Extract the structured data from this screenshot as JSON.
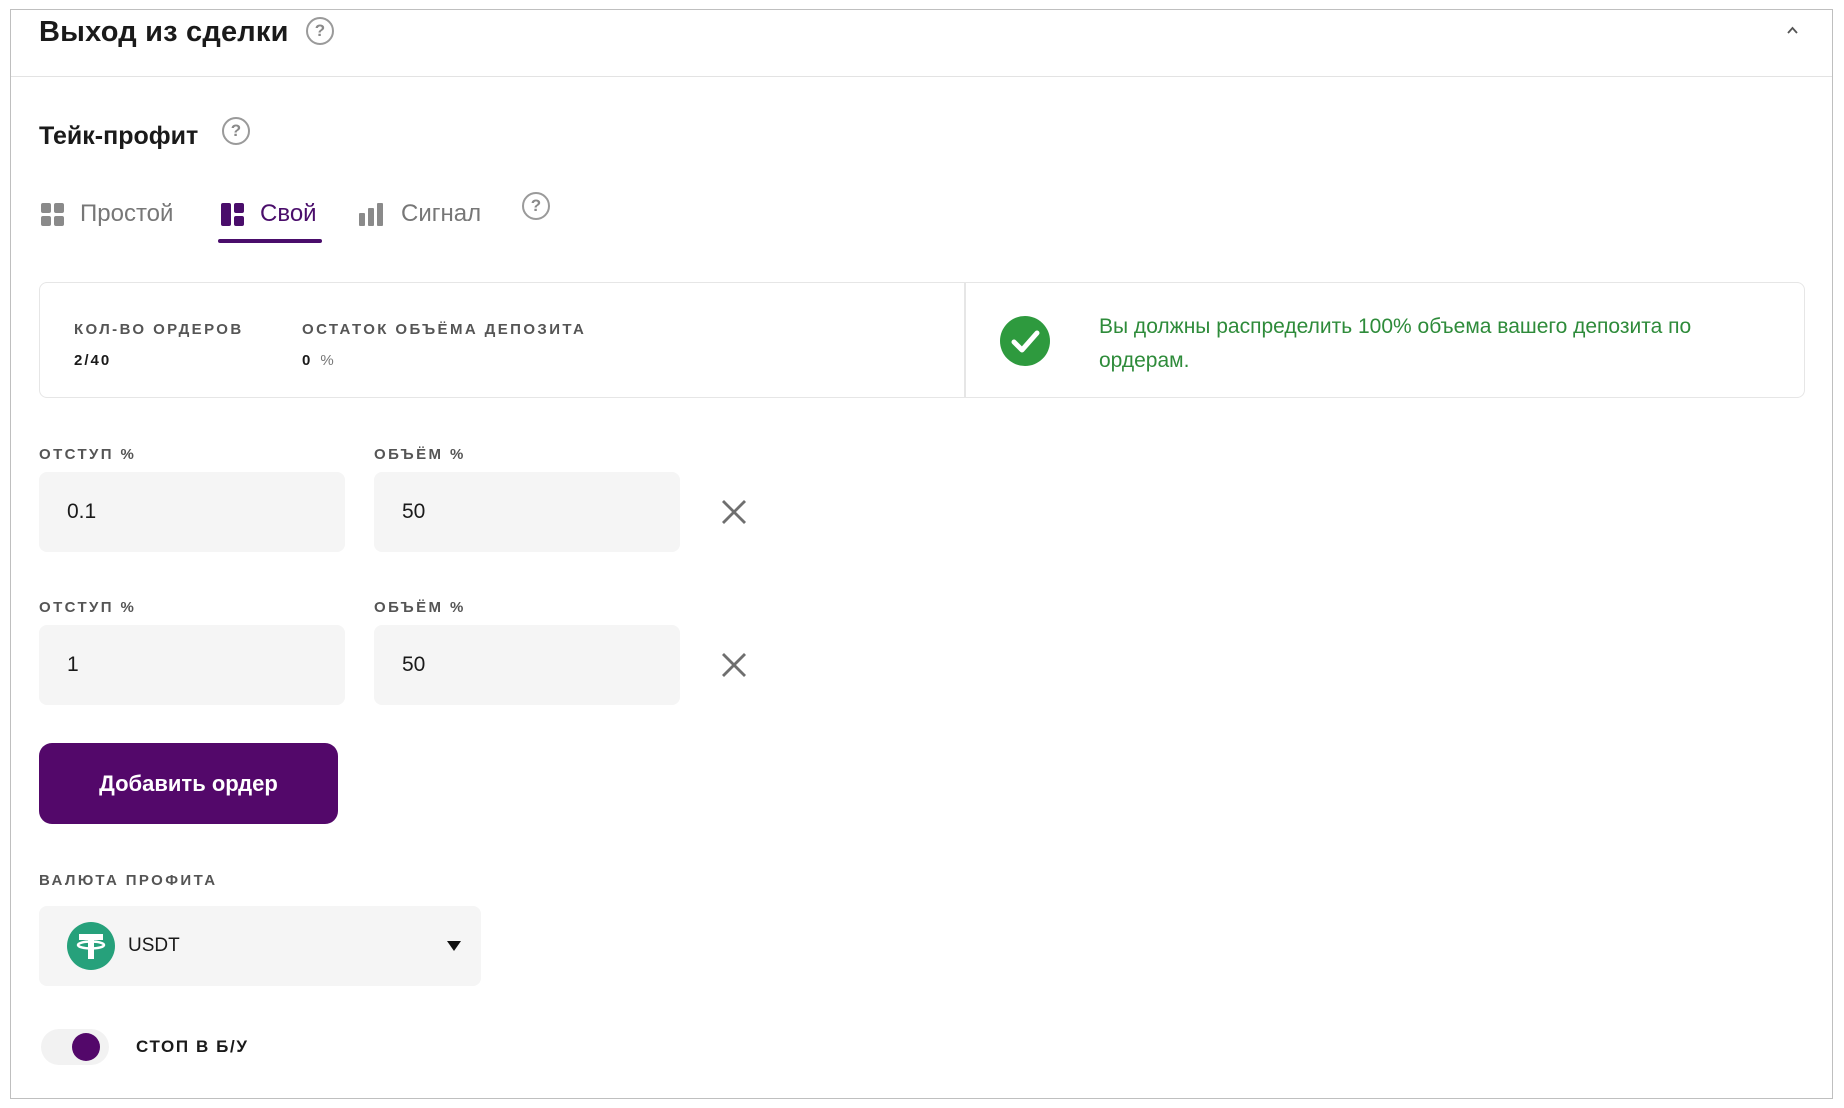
{
  "header": {
    "title": "Выход из сделки",
    "help_glyph": "?"
  },
  "section": {
    "title": "Тейк-профит",
    "help_glyph": "?"
  },
  "tabs": [
    {
      "label": "Простой",
      "icon": "grid-icon",
      "active": false
    },
    {
      "label": "Свой",
      "icon": "layout-icon",
      "active": true
    },
    {
      "label": "Сигнал",
      "icon": "bar-chart-icon",
      "active": false
    }
  ],
  "tabs_help_glyph": "?",
  "stats": {
    "orders_label": "КОЛ-ВО ОРДЕРОВ",
    "orders_value": "2/40",
    "remaining_label": "ОСТАТОК ОБЪЁМА ДЕПОЗИТА",
    "remaining_value": "0",
    "remaining_unit": "%",
    "message": "Вы должны распределить 100% объема вашего депозита по ордерам."
  },
  "orders": [
    {
      "offset_label": "ОТСТУП %",
      "offset": "0.1",
      "volume_label": "ОБЪЁМ %",
      "volume": "50"
    },
    {
      "offset_label": "ОТСТУП %",
      "offset": "1",
      "volume_label": "ОБЪЁМ %",
      "volume": "50"
    }
  ],
  "add_button": "Добавить ордер",
  "profit_currency": {
    "label": "ВАЛЮТА ПРОФИТА",
    "value": "USDT",
    "icon": "tether-icon"
  },
  "stop_toggle": {
    "label": "СТОП В Б/У",
    "enabled": true
  },
  "colors": {
    "accent": "#53086a",
    "success": "#2e9a3e",
    "tether": "#26a17b"
  }
}
